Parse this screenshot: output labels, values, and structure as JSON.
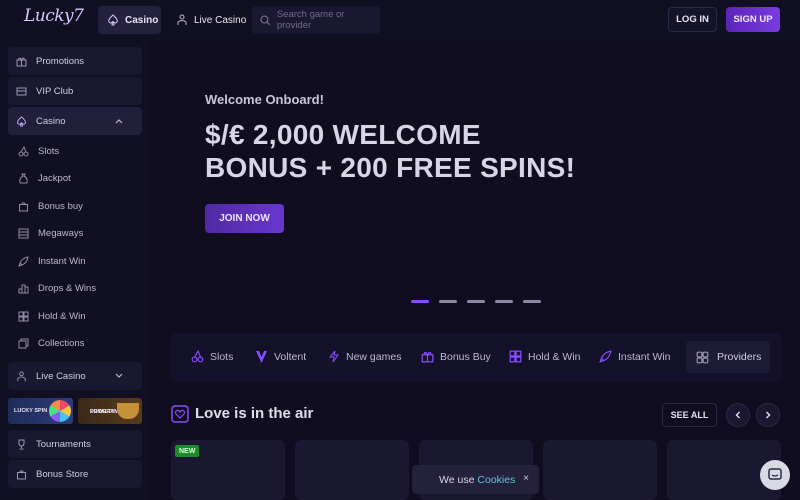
{
  "header": {
    "logo_text": "Lucky7",
    "tabs": [
      {
        "label": "Casino",
        "icon": "spade-icon"
      },
      {
        "label": "Live Casino",
        "icon": "dealer-icon"
      }
    ],
    "search_placeholder": "Search game or provider",
    "login_label": "LOG IN",
    "signup_label": "SIGN UP"
  },
  "sidebar": {
    "top_items": [
      {
        "label": "Promotions",
        "icon": "gift-icon"
      },
      {
        "label": "VIP Club",
        "icon": "crown-icon"
      },
      {
        "label": "Casino",
        "icon": "spade-icon"
      }
    ],
    "casino_subitems": [
      {
        "label": "Slots",
        "icon": "cherries-icon"
      },
      {
        "label": "Jackpot",
        "icon": "money-bag-icon"
      },
      {
        "label": "Bonus buy",
        "icon": "shopping-bag-icon"
      },
      {
        "label": "Megaways",
        "icon": "layers-icon"
      },
      {
        "label": "Instant Win",
        "icon": "rocket-icon"
      },
      {
        "label": "Drops & Wins",
        "icon": "podium-icon"
      },
      {
        "label": "Hold & Win",
        "icon": "grid-icon"
      },
      {
        "label": "Collections",
        "icon": "collection-icon"
      }
    ],
    "live_casino_label": "Live Casino",
    "promo_cards": [
      {
        "label": "LUCKY SPIN"
      },
      {
        "label_line1": "LOYALTY",
        "label_line2": "PROGRAM"
      }
    ],
    "bottom_items": [
      {
        "label": "Tournaments",
        "icon": "trophy-icon"
      },
      {
        "label": "Bonus Store",
        "icon": "store-icon"
      }
    ]
  },
  "hero": {
    "subtitle": "Welcome Onboard!",
    "title_line1": "$/€ 2,000 WELCOME",
    "title_line2": "BONUS + 200 FREE SPINS!",
    "cta_label": "JOIN NOW",
    "slide_count": 5,
    "active_slide": 1
  },
  "categories": [
    {
      "label": "Slots",
      "icon": "cherries-icon"
    },
    {
      "label": "Voltent",
      "icon": "v-logo-icon"
    },
    {
      "label": "New games",
      "icon": "lightning-icon"
    },
    {
      "label": "Bonus Buy",
      "icon": "gift-icon"
    },
    {
      "label": "Hold & Win",
      "icon": "grid-icon"
    },
    {
      "label": "Instant Win",
      "icon": "rocket-icon"
    }
  ],
  "providers_label": "Providers",
  "section": {
    "title": "Love is in the air",
    "see_all_label": "SEE ALL",
    "new_badge": "NEW"
  },
  "cookie": {
    "text": "We use",
    "link": "Cookies",
    "close": "×"
  },
  "colors": {
    "background": "#0f0d1f",
    "accent": "#7a3be0",
    "active_dot": "#8b4dff",
    "new_badge": "#1d8a2c",
    "cookie_link": "#5fc7d8"
  }
}
